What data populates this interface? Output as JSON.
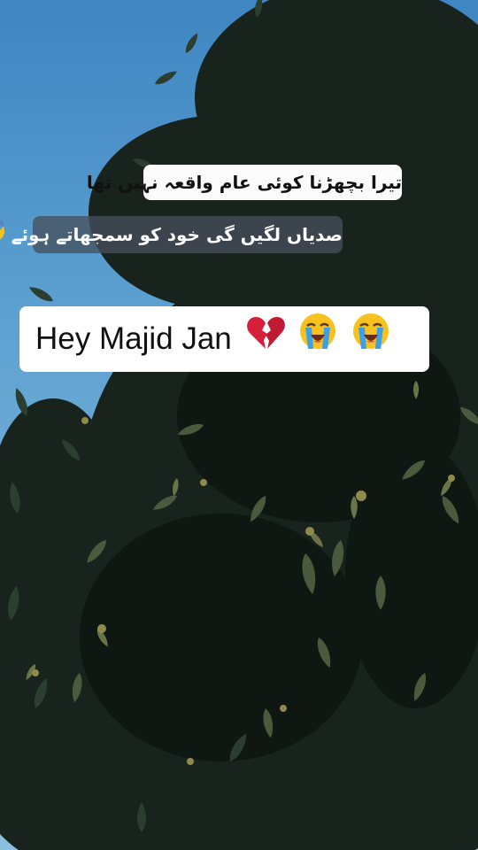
{
  "captions": {
    "line1": "تیرا بچھڑنا کوئی عام واقعہ نہیں تھا",
    "line2": "صدیاں لگیں گی خود کو سمجھاتے ہوئے",
    "line2_emoji": "anxious-face-with-sweat",
    "line3": "Hey Majid Jan",
    "line3_emojis": [
      "broken-heart",
      "loudly-crying-face",
      "loudly-crying-face"
    ]
  },
  "colors": {
    "sky": "#5b9fd0",
    "foliage": "#1c2a22",
    "caption_light": "#ffffff",
    "caption_dark": "#46505c",
    "broken_heart": "#d61f3a",
    "emoji_yellow": "#f7c21d",
    "emoji_tear": "#3da0e6"
  }
}
